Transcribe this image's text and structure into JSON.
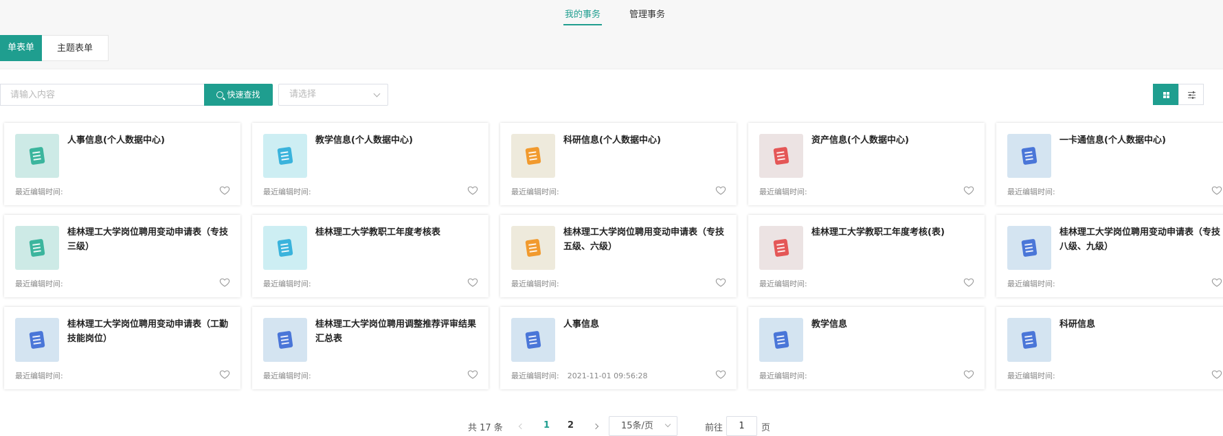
{
  "top_tabs": [
    {
      "label": "我的事务",
      "active": true
    },
    {
      "label": "管理事务",
      "active": false
    }
  ],
  "sub_tabs": [
    {
      "label": "单表单",
      "active": true
    },
    {
      "label": "主题表单",
      "active": false
    }
  ],
  "search": {
    "placeholder": "请输入内容",
    "value": "",
    "button_label": "快速查找"
  },
  "select": {
    "placeholder": "请选择"
  },
  "view_modes": [
    "grid-view-icon",
    "list-view-icon"
  ],
  "accent_color": "#1f9e8f",
  "meta_label": "最近编辑时间:",
  "cards": [
    {
      "title": "人事信息(个人数据中心)",
      "time": "",
      "theme": "teal"
    },
    {
      "title": "教学信息(个人数据中心)",
      "time": "",
      "theme": "cyan"
    },
    {
      "title": "科研信息(个人数据中心)",
      "time": "",
      "theme": "orange"
    },
    {
      "title": "资产信息(个人数据中心)",
      "time": "",
      "theme": "red"
    },
    {
      "title": "一卡通信息(个人数据中心)",
      "time": "",
      "theme": "blue"
    },
    {
      "title": "桂林理工大学岗位聘用变动申请表（专技三级）",
      "time": "",
      "theme": "teal"
    },
    {
      "title": "桂林理工大学教职工年度考核表",
      "time": "",
      "theme": "cyan"
    },
    {
      "title": "桂林理工大学岗位聘用变动申请表（专技五级、六级）",
      "time": "",
      "theme": "orange"
    },
    {
      "title": "桂林理工大学教职工年度考核(表)",
      "time": "",
      "theme": "red"
    },
    {
      "title": "桂林理工大学岗位聘用变动申请表（专技八级、九级）",
      "time": "",
      "theme": "blue"
    },
    {
      "title": "桂林理工大学岗位聘用变动申请表（工勤技能岗位）",
      "time": "",
      "theme": "blue"
    },
    {
      "title": "桂林理工大学岗位聘用调整推荐评审结果汇总表",
      "time": "",
      "theme": "blue"
    },
    {
      "title": "人事信息",
      "time": "2021-11-01 09:56:28",
      "theme": "blue"
    },
    {
      "title": "教学信息",
      "time": "",
      "theme": "blue"
    },
    {
      "title": "科研信息",
      "time": "",
      "theme": "blue"
    }
  ],
  "themes": {
    "teal": {
      "bg": "#cdeae6",
      "fg": "#3bb59d"
    },
    "cyan": {
      "bg": "#cdeef3",
      "fg": "#3ab3dc"
    },
    "orange": {
      "bg": "#eeeadc",
      "fg": "#f19a2e"
    },
    "red": {
      "bg": "#ece3e3",
      "fg": "#e45757"
    },
    "blue": {
      "bg": "#d4e4f1",
      "fg": "#4a76d8"
    }
  },
  "pagination": {
    "total": "共 17 条",
    "pages": [
      "1",
      "2"
    ],
    "current": "1",
    "page_size": "15条/页",
    "goto_label": "前往",
    "goto_value": "1",
    "goto_suffix": "页"
  }
}
